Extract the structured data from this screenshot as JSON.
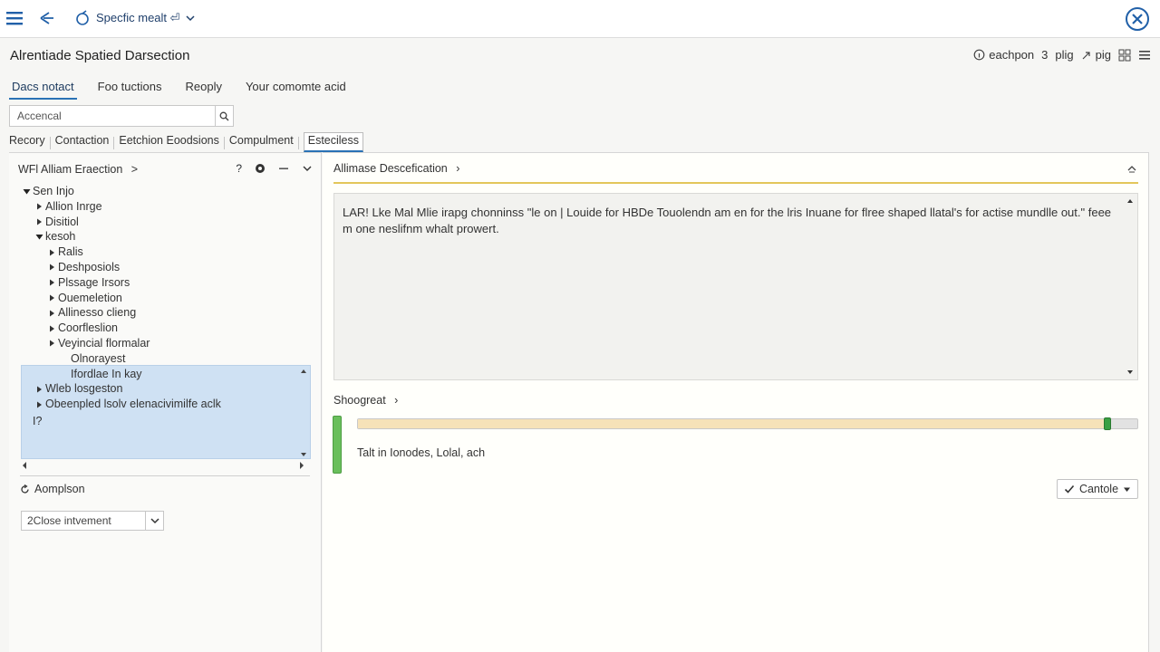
{
  "topbar": {
    "app_name": "Specfic mealt ⏎",
    "icons": {
      "menu": "hamburger-icon",
      "back": "back-arrow-icon",
      "app": "app-logo-icon",
      "close": "close-circle-icon"
    }
  },
  "header": {
    "title": "Alrentiade Spatied Darsection",
    "actions": {
      "search": "eachpon",
      "count": "3",
      "plig": "plig",
      "pig": "pig"
    }
  },
  "main_tabs": [
    {
      "label": "Dacs notact",
      "active": true
    },
    {
      "label": "Foo tuctions"
    },
    {
      "label": "Reoply"
    },
    {
      "label": "Your comomte acid"
    }
  ],
  "search": {
    "value": "Accencal",
    "placeholder": "Accencal"
  },
  "sub_tabs": [
    {
      "label": "Recory"
    },
    {
      "label": "Contaction"
    },
    {
      "label": "Eetchion Eoodsions"
    },
    {
      "label": "Compulment"
    },
    {
      "label": "Esteciless",
      "active": true
    }
  ],
  "left_panel": {
    "title": "WFl Alliam Eraection",
    "chevron": ">",
    "help": "?",
    "tree": {
      "root": "Sen Injo",
      "children": [
        "Allion Inrge",
        "Disitiol"
      ],
      "expanded": "kesoh",
      "sub_items": [
        "Ralis",
        "Deshposiols",
        "Plssage Irsors",
        "Ouemeletion",
        "Allinesso clieng",
        "Coorfleslion",
        "Veyincial flormalar"
      ],
      "leaf_items": [
        "Olnorayest",
        "Ifordlae In kay"
      ],
      "after_items": [
        "Wleb losgeston",
        "Obeenpled lsolv elenacivimilfe aclk"
      ],
      "cursor": "I?"
    },
    "comparison_label": "Aomplson",
    "dropdown_value": "2Close intvement"
  },
  "right_panel": {
    "header": "Allimase Descefication",
    "chevron": "›",
    "description": "LAR! Lke Mal Mlie irapg chonninss \"le on | Louide for HBDe Touolendn am en for the lris Inuane for flree shaped llatal's for actise mundlle out.\" feee m one neslifnm whalt prowert.",
    "shoot_header": "Shoogreat",
    "progress": 0.962,
    "result_text": "Talt in Ionodes, Lolal, ach",
    "cancel_label": "Cantole"
  }
}
